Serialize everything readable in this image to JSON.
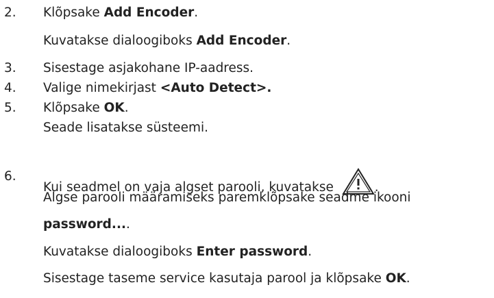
{
  "steps": [
    {
      "number": "2.",
      "line1": {
        "pre": "Klõpsake ",
        "bold": "Add Encoder",
        "post": "."
      },
      "line2": {
        "pre": "Kuvatakse dialoogiboks ",
        "bold": "Add Encoder",
        "post": "."
      }
    },
    {
      "number": "3.",
      "line1": {
        "text": "Sisestage asjakohane IP-aadress."
      }
    },
    {
      "number": "4.",
      "line1": {
        "pre": "Valige nimekirjast ",
        "bold": "<Auto Detect>."
      }
    },
    {
      "number": "5.",
      "line1": {
        "pre": "Klõpsake ",
        "bold": "OK",
        "post": "."
      },
      "line2": {
        "text": "Seade lisatakse süsteemi."
      }
    },
    {
      "number": "6.",
      "line1": {
        "pre": "Kui seadmel on vaja algset parooli, kuvatakse ",
        "icon": "warning-triangle-icon",
        "post": "."
      },
      "line2": {
        "text": "Algse parooli määramiseks paremklõpsake seadme ikooni"
      },
      "line3": {
        "bold": "password...",
        "post": "."
      },
      "line4": {
        "pre": "Kuvatakse dialoogiboks ",
        "bold": "Enter password",
        "post": "."
      },
      "line5": {
        "pre": "Sisestage taseme service kasutaja parool ja klõpsake ",
        "bold": "OK",
        "post": "."
      }
    }
  ]
}
